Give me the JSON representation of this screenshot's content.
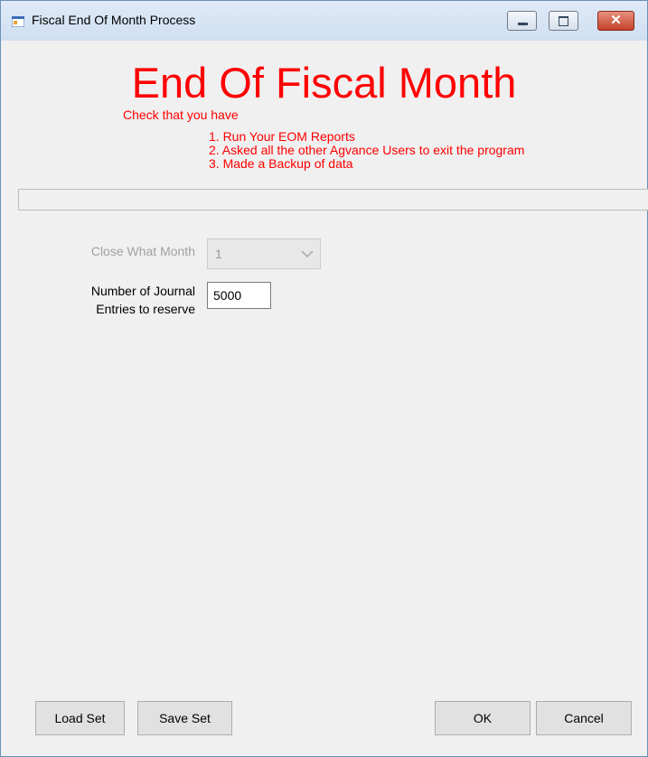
{
  "window": {
    "title": "Fiscal End Of Month Process",
    "close_glyph": "✕"
  },
  "banner": {
    "heading": "End Of Fiscal Month",
    "check_label": "Check that you have",
    "steps": [
      "1. Run Your EOM Reports",
      "2. Asked all the other Agvance Users to exit the program",
      "3. Made a Backup of data"
    ]
  },
  "form": {
    "close_month_label": "Close What Month",
    "close_month_value": "1",
    "journal_label_line1": "Number of Journal",
    "journal_label_line2": "Entries to reserve",
    "journal_entries_value": "5000"
  },
  "buttons": {
    "load_set": "Load Set",
    "save_set": "Save Set",
    "ok": "OK",
    "cancel": "Cancel"
  },
  "colors": {
    "warning_text": "#ff0000",
    "disabled_text": "#a0a0a0",
    "window_bg": "#f0f0f0"
  },
  "icons": {
    "app": "app-window-icon",
    "minimize": "minimize-icon",
    "maximize": "maximize-icon",
    "close": "close-icon",
    "dropdown": "chevron-down-icon"
  }
}
